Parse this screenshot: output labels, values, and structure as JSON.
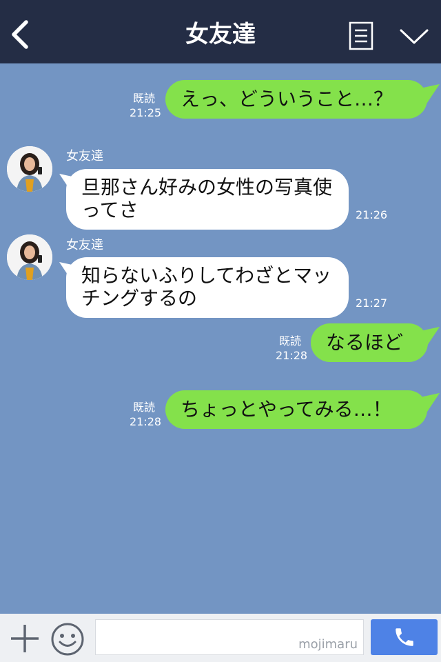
{
  "header": {
    "title": "女友達",
    "back_icon": "chevron-left-icon",
    "menu_icon": "notes-icon",
    "dropdown_icon": "chevron-down-icon"
  },
  "colors": {
    "header_bg": "#242d45",
    "chat_bg": "#7395c3",
    "sent_bubble": "#84e14b",
    "received_bubble": "#ffffff",
    "send_button": "#4e82e6"
  },
  "messages": [
    {
      "direction": "sent",
      "text": "えっ、どういうこと…？",
      "read_label": "既読",
      "time": "21:25"
    },
    {
      "direction": "received",
      "sender": "女友達",
      "text": "旦那さん好みの女性の写真使ってさ",
      "time": "21:26"
    },
    {
      "direction": "received",
      "sender": "女友達",
      "text": "知らないふりしてわざとマッチングするの",
      "time": "21:27"
    },
    {
      "direction": "sent",
      "text": "なるほど",
      "read_label": "既読",
      "time": "21:28"
    },
    {
      "direction": "sent",
      "text": "ちょっとやってみる…！",
      "read_label": "既読",
      "time": "21:28"
    }
  ],
  "footer": {
    "plus_icon": "plus-icon",
    "emoji_icon": "smiley-icon",
    "input_value": "",
    "watermark": "mojimaru",
    "send_icon": "phone-icon"
  }
}
